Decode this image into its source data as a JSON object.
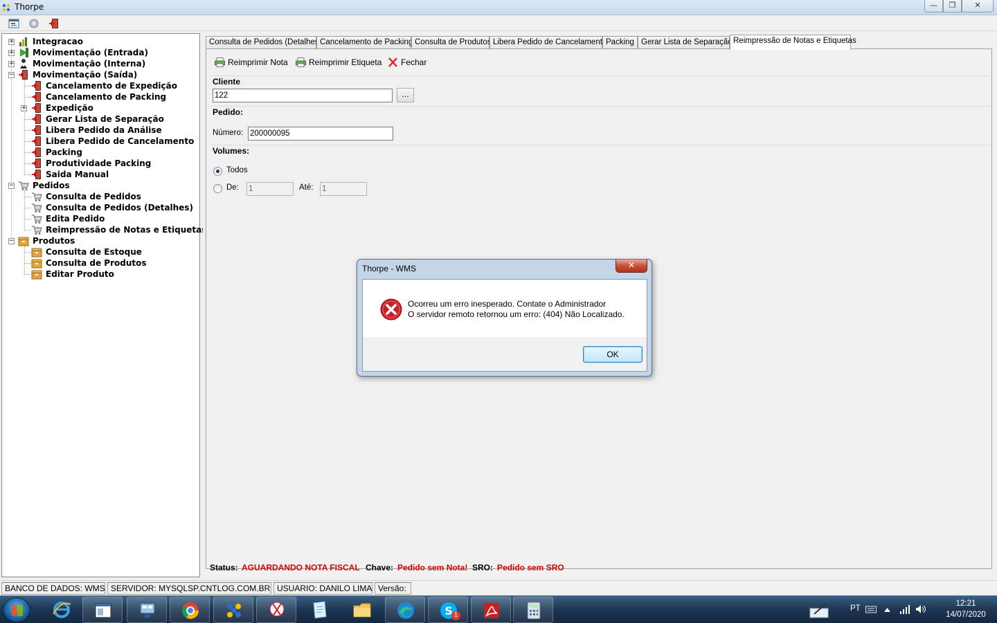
{
  "window": {
    "title": "Thorpe",
    "controls": {
      "minimize": "—",
      "maximize": "❐",
      "close": "✕"
    }
  },
  "tree": {
    "items": [
      {
        "label": "Integracao",
        "level": 0,
        "expander": "+",
        "icon": "chart-icon"
      },
      {
        "label": "Movimentação (Entrada)",
        "level": 0,
        "expander": "+",
        "icon": "arrow-in-icon"
      },
      {
        "label": "Movimentação (Interna)",
        "level": 0,
        "expander": "+",
        "icon": "person-icon"
      },
      {
        "label": "Movimentação (Saída)",
        "level": 0,
        "expander": "−",
        "icon": "exit-door-icon"
      },
      {
        "label": "Cancelamento de Expedição",
        "level": 1,
        "icon": "exit-door-icon"
      },
      {
        "label": "Cancelamento de Packing",
        "level": 1,
        "icon": "exit-door-icon"
      },
      {
        "label": "Expedição",
        "level": 1,
        "expander": "+",
        "icon": "exit-door-icon"
      },
      {
        "label": "Gerar Lista de Separação",
        "level": 1,
        "icon": "exit-door-icon"
      },
      {
        "label": "Libera Pedido da Análise",
        "level": 1,
        "icon": "exit-door-icon"
      },
      {
        "label": "Libera Pedido de Cancelamento",
        "level": 1,
        "icon": "exit-door-icon"
      },
      {
        "label": "Packing",
        "level": 1,
        "icon": "exit-door-icon"
      },
      {
        "label": "Produtividade Packing",
        "level": 1,
        "icon": "exit-door-icon"
      },
      {
        "label": "Saida Manual",
        "level": 1,
        "icon": "exit-door-icon"
      },
      {
        "label": "Pedidos",
        "level": 0,
        "expander": "−",
        "icon": "cart-icon"
      },
      {
        "label": "Consulta de Pedidos",
        "level": 1,
        "icon": "cart-icon"
      },
      {
        "label": "Consulta de Pedidos (Detalhes)",
        "level": 1,
        "icon": "cart-icon"
      },
      {
        "label": "Edita Pedido",
        "level": 1,
        "icon": "cart-icon"
      },
      {
        "label": "Reimpressão de Notas e Etiquetas",
        "level": 1,
        "icon": "cart-icon"
      },
      {
        "label": "Produtos",
        "level": 0,
        "expander": "−",
        "icon": "box-icon"
      },
      {
        "label": "Consulta de Estoque",
        "level": 1,
        "icon": "box-icon"
      },
      {
        "label": "Consulta de Produtos",
        "level": 1,
        "icon": "box-icon"
      },
      {
        "label": "Editar Produto",
        "level": 1,
        "icon": "box-icon"
      }
    ]
  },
  "tabs": [
    {
      "label": "Consulta de Pedidos (Detalhes)"
    },
    {
      "label": "Cancelamento de Packing"
    },
    {
      "label": "Consulta de Produtos"
    },
    {
      "label": "Libera Pedido de Cancelamento"
    },
    {
      "label": "Packing"
    },
    {
      "label": "Gerar Lista de Separação"
    },
    {
      "label": "Reimpressão de Notas e Etiquetas",
      "active": true
    }
  ],
  "actions": {
    "reprint_note": "Reimprimir Nota",
    "reprint_label": "Reimprimir Etiqueta",
    "close": "Fechar"
  },
  "form": {
    "client_title": "Cliente",
    "client_value": "122",
    "browse_label": "...",
    "order_title": "Pedido:",
    "number_label": "Número:",
    "number_value": "200000095",
    "volumes_title": "Volumes:",
    "all_label": "Todos",
    "from_label": "De:",
    "from_value": "1",
    "to_label": "Até:",
    "to_value": "1"
  },
  "status_line": {
    "status_label": "Status:",
    "status_value": "AGUARDANDO NOTA FISCAL",
    "key_label": "Chave:",
    "key_value": "Pedido sem Nota!",
    "sro_label": "SRO:",
    "sro_value": "Pedido sem SRO"
  },
  "statusbar": {
    "database": "BANCO DE DADOS: WMS",
    "server": "SERVIDOR: MYSQLSP.CNTLOG.COM.BR",
    "user": "USUARIO: DANILO LIMA",
    "version": "Versão:"
  },
  "dialog": {
    "title": "Thorpe - WMS",
    "close": "✕",
    "line1": "Ocorreu um erro inesperado. Contate o Administrador",
    "line2": "O servidor remoto retornou um erro: (404) Não Localizado.",
    "ok": "OK"
  },
  "taskbar": {
    "apps": [
      "internet-explorer-icon",
      "window-icon",
      "network-icon",
      "chrome-icon",
      "thorpe-icon",
      "snipping-tool-icon",
      "notepad-icon",
      "folder-icon",
      "edge-icon",
      "skype-icon",
      "acrobat-icon",
      "calculator-icon"
    ],
    "skype_badge": "1",
    "language": "PT",
    "time": "12:21",
    "date": "14/07/2020"
  },
  "colors": {
    "status_red": "#e00000",
    "taskbar": "#1c3552",
    "dialog_frame": "#c4d5e8"
  }
}
